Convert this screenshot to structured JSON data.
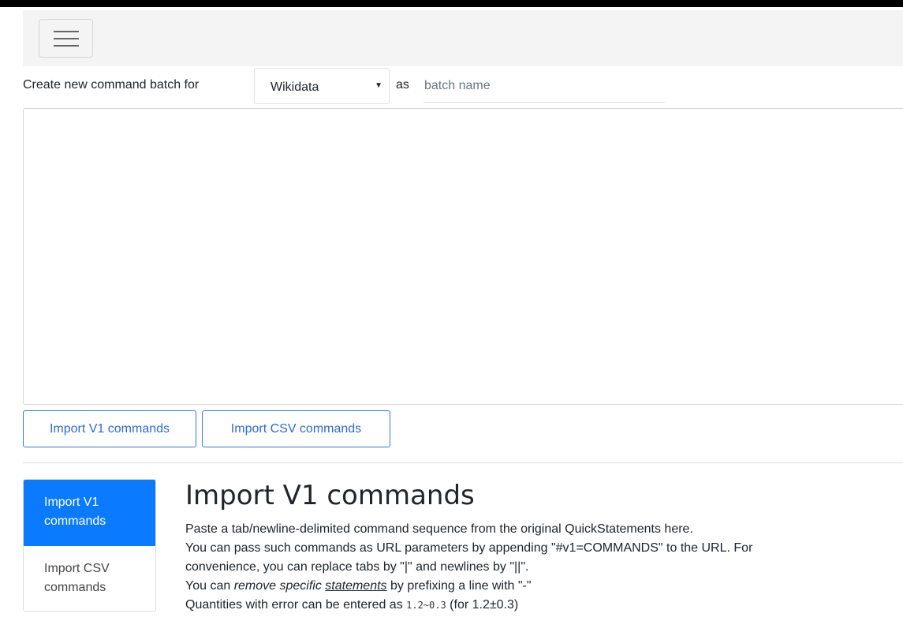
{
  "navbar": {
    "menu_icon": "hamburger-menu-icon"
  },
  "create": {
    "label": "Create new command batch for",
    "project_selected": "Wikidata",
    "as_label": "as",
    "batch_name_placeholder": "batch name"
  },
  "buttons": {
    "import_v1": "Import V1 commands",
    "import_csv": "Import CSV commands"
  },
  "tabs": {
    "v1": {
      "line1": "Import V1",
      "line2": "commands"
    },
    "csv": {
      "line1": "Import CSV",
      "line2": "commands"
    }
  },
  "panel": {
    "title": "Import V1 commands",
    "line1": "Paste a tab/newline-delimited command sequence from the original QuickStatements here.",
    "line2a": "You can pass such commands as URL parameters by appending \"#v1=COMMANDS\" to the URL. For",
    "line2b": "convenience, you can replace tabs by \"|\" and newlines by \"||\".",
    "line3_pre": "You can ",
    "line3_em": "remove specific ",
    "line3_link": "statements",
    "line3_post": " by prefixing a line with \"-\"",
    "line4_pre": "Quantities with error can be entered as ",
    "line4_code": "1.2~0.3",
    "line4_post": " (for 1.2±0.3)"
  },
  "colors": {
    "primary": "#0a7bff",
    "outline": "#3a76d8"
  }
}
